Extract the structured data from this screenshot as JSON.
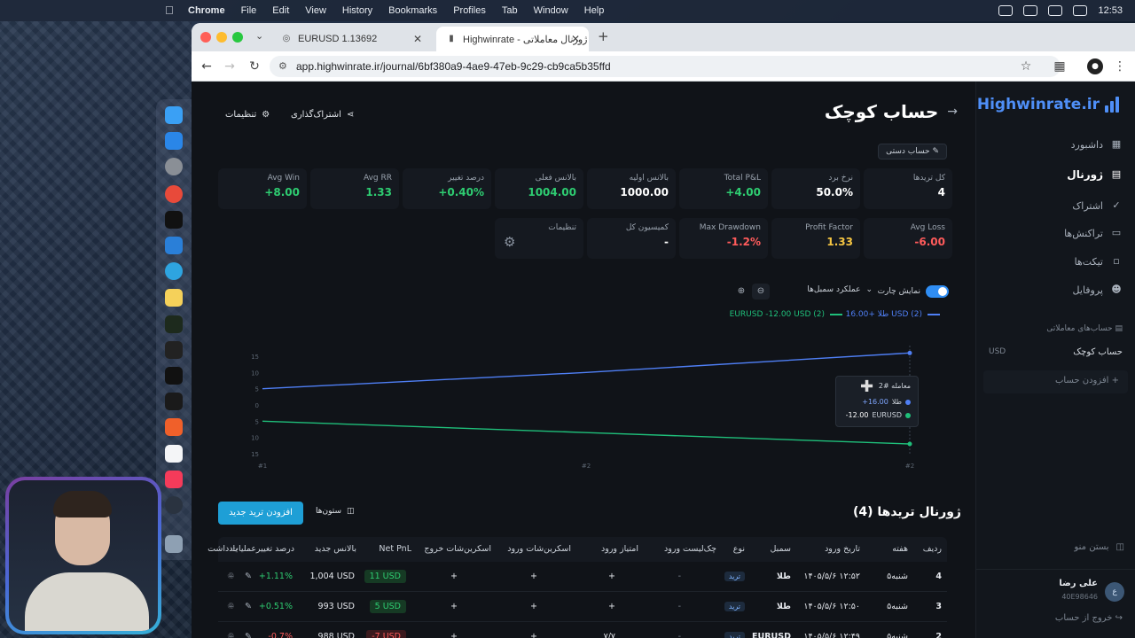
{
  "menubar": {
    "app": "Chrome",
    "items": [
      "File",
      "Edit",
      "View",
      "History",
      "Bookmarks",
      "Profiles",
      "Tab",
      "Window",
      "Help"
    ],
    "clock": "12:53"
  },
  "browser": {
    "tabs": [
      {
        "title": "EURUSD 1.13692"
      },
      {
        "title": "Highwinrate - ژورنال معاملاتی"
      }
    ],
    "url": "app.highwinrate.ir/journal/6bf380a9-4ae9-47eb-9c29-cb9ca5b35ffd"
  },
  "sidebar": {
    "brand": "Highwinrate.ir",
    "nav": [
      {
        "label": "داشبورد",
        "icon": "grid-icon"
      },
      {
        "label": "ژورنال",
        "icon": "book-icon"
      },
      {
        "label": "اشتراک",
        "icon": "check-circle-icon"
      },
      {
        "label": "تراکنش‌ها",
        "icon": "card-icon"
      },
      {
        "label": "تیکت‌ها",
        "icon": "ticket-icon"
      },
      {
        "label": "پروفایل",
        "icon": "user-icon"
      }
    ],
    "section_title": "حساب‌های معاملاتی",
    "account": {
      "name": "حساب کوچک",
      "currency": "USD"
    },
    "add_account": "افزودن حساب",
    "close_menu": "بستن منو",
    "user": {
      "name": "علی رضا",
      "id": "40E98646",
      "initial": "ع"
    },
    "logout": "خروج از حساب"
  },
  "header": {
    "title": "حساب کوچک",
    "share": "اشتراک‌گذاری",
    "settings": "تنظیمات",
    "manual_badge": "حساب دستی"
  },
  "stats_row1": [
    {
      "label": "کل تریدها",
      "value": "4",
      "tone": "white"
    },
    {
      "label": "نرخ برد",
      "value": "50.0%",
      "tone": "white"
    },
    {
      "label": "Total P&L",
      "value": "+4.00",
      "tone": "green"
    },
    {
      "label": "بالانس اولیه",
      "value": "1000.00",
      "tone": "white"
    },
    {
      "label": "بالانس فعلی",
      "value": "1004.00",
      "tone": "green"
    },
    {
      "label": "درصد تغییر",
      "value": "+0.40%",
      "tone": "green"
    },
    {
      "label": "Avg RR",
      "value": "1.33",
      "tone": "green"
    },
    {
      "label": "Avg Win",
      "value": "+8.00",
      "tone": "green"
    }
  ],
  "stats_row2": [
    {
      "label": "Avg Loss",
      "value": "-6.00",
      "tone": "red"
    },
    {
      "label": "Profit Factor",
      "value": "1.33",
      "tone": "yellow"
    },
    {
      "label": "Max Drawdown",
      "value": "-1.2%",
      "tone": "red"
    },
    {
      "label": "کمیسیون کل",
      "value": "-",
      "tone": "white"
    },
    {
      "label": "تنظیمات",
      "value": "",
      "tone": "white"
    }
  ],
  "chart_controls": {
    "show_chart": "نمایش چارت",
    "dropdown": "عملکرد سمبل‌ها"
  },
  "chart_data": {
    "type": "line",
    "x": [
      "#1",
      "#2",
      "#2"
    ],
    "yticks": [
      "15",
      "10",
      "5",
      "0",
      "5",
      "10",
      "15"
    ],
    "ylim": [
      -15,
      15
    ],
    "series": [
      {
        "name": "طلا",
        "color": "#4f7ff5",
        "values": [
          5,
          10,
          16
        ],
        "legend": "طلا  +16.00 USD (2)"
      },
      {
        "name": "EURUSD",
        "color": "#1fbf7a",
        "values": [
          -5,
          -8.5,
          -12
        ],
        "legend": "EURUSD  -12.00 USD (2)"
      }
    ],
    "tooltip": {
      "title": "معامله #2",
      "rows": [
        {
          "name": "طلا",
          "value": "+16.00",
          "color": "#4f7ff5"
        },
        {
          "name": "EURUSD",
          "value": "-12.00",
          "color": "#1fbf7a"
        }
      ]
    }
  },
  "journal": {
    "title": "ژورنال تریدها (4)",
    "add_button": "افزودن ترید جدید",
    "columns_button": "ستون‌ها",
    "headers": [
      "ردیف",
      "هفته",
      "تاریخ ورود",
      "سمبل",
      "نوع",
      "چک‌لیست ورود",
      "امتیاز ورود",
      "اسکرین‌شات ورود",
      "اسکرین‌شات خروج",
      "Net PnL",
      "بالانس جدید",
      "درصد تغییر",
      "یادداشت",
      "عملیات"
    ],
    "rows": [
      {
        "idx": "4",
        "week": "۵شنبه",
        "date": "۱۴۰۵/۵/۶ ۱۲:۵۲",
        "symbol": "طلا",
        "type": "ترید",
        "checklist": "-",
        "score": "+",
        "shot_in": "+",
        "shot_out": "+",
        "pnl": "11 USD",
        "pnl_tone": "green",
        "balance": "1,004 USD",
        "change": "+1.11%",
        "change_tone": "green",
        "note": "-"
      },
      {
        "idx": "3",
        "week": "۵شنبه",
        "date": "۱۴۰۵/۵/۶ ۱۲:۵۰",
        "symbol": "طلا",
        "type": "ترید",
        "checklist": "-",
        "score": "+",
        "shot_in": "+",
        "shot_out": "+",
        "pnl": "5 USD",
        "pnl_tone": "green",
        "balance": "993 USD",
        "change": "+0.51%",
        "change_tone": "green",
        "note": "-"
      },
      {
        "idx": "2",
        "week": "۵شنبه",
        "date": "۱۴۰۵/۵/۶ ۱۲:۴۹",
        "symbol": "EURUSD",
        "type": "ترید",
        "checklist": "-",
        "score": "۷/۷",
        "shot_in": "+",
        "shot_out": "+",
        "pnl": "-7 USD",
        "pnl_tone": "red",
        "balance": "988 USD",
        "change": "-0.7%",
        "change_tone": "red",
        "note": "-"
      }
    ]
  }
}
